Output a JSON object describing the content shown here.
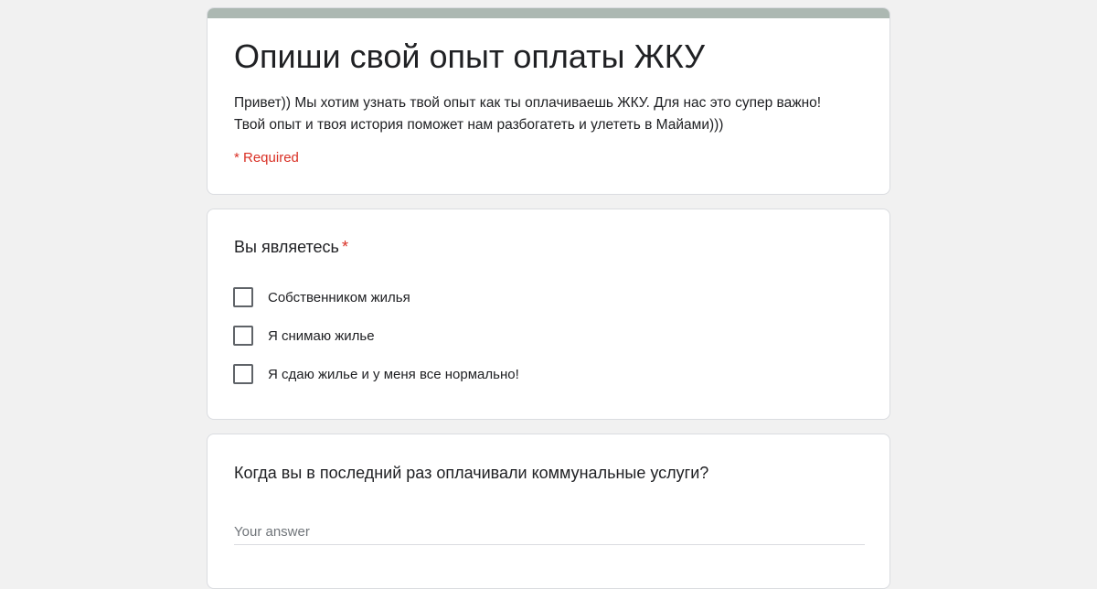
{
  "form": {
    "title": "Опиши свой опыт оплаты ЖКУ",
    "description": "Привет)) Мы хотим узнать твой опыт как ты оплачиваешь ЖКУ. Для нас это супер важно! Твой опыт и твоя история поможет нам разбогатеть и улететь в Майами)))",
    "required_note": "* Required",
    "accent_color": "#acb8b2",
    "required_color": "#d93025"
  },
  "questions": [
    {
      "title": "Вы являетесь",
      "required_mark": "*",
      "options": [
        {
          "label": "Собственником жилья",
          "checked": false
        },
        {
          "label": "Я снимаю жилье",
          "checked": false
        },
        {
          "label": "Я сдаю жилье и у меня все нормально!",
          "checked": false
        }
      ]
    },
    {
      "title": "Когда вы в последний раз оплачивали коммунальные услуги?",
      "answer_value": "",
      "answer_placeholder": "Your answer"
    }
  ]
}
